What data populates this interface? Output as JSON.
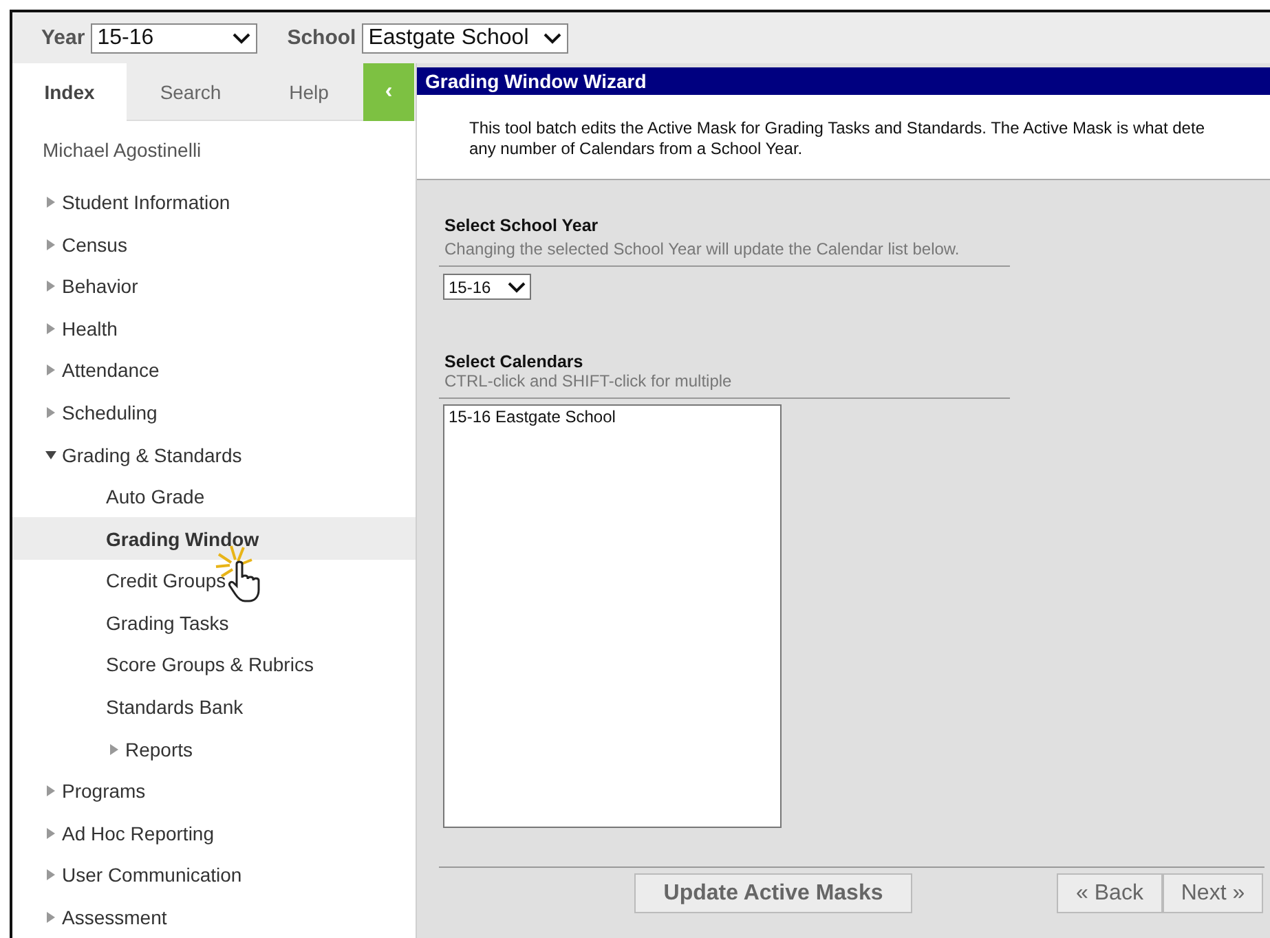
{
  "top_bar": {
    "year": {
      "label": "Year",
      "value": "15-16"
    },
    "school": {
      "label": "School",
      "value": "Eastgate School"
    }
  },
  "tabs": [
    {
      "label": "Index",
      "selected": true
    },
    {
      "label": "Search",
      "selected": false
    },
    {
      "label": "Help",
      "selected": false
    }
  ],
  "collapse_button": "‹",
  "user_name": "Michael Agostinelli",
  "tree": [
    {
      "label": "Student Information",
      "kind": "folder",
      "expanded": false,
      "selected": false
    },
    {
      "label": "Census",
      "kind": "folder",
      "expanded": false,
      "selected": false
    },
    {
      "label": "Behavior",
      "kind": "folder",
      "expanded": false,
      "selected": false
    },
    {
      "label": "Health",
      "kind": "folder",
      "expanded": false,
      "selected": false
    },
    {
      "label": "Attendance",
      "kind": "folder",
      "expanded": false,
      "selected": false
    },
    {
      "label": "Scheduling",
      "kind": "folder",
      "expanded": false,
      "selected": false
    },
    {
      "label": "Grading & Standards",
      "kind": "folder",
      "expanded": true,
      "selected": false,
      "children": [
        {
          "label": "Auto Grade",
          "kind": "leaf",
          "selected": false
        },
        {
          "label": "Grading Window",
          "kind": "leaf",
          "selected": true
        },
        {
          "label": "Credit Groups",
          "kind": "leaf",
          "selected": false
        },
        {
          "label": "Grading Tasks",
          "kind": "leaf",
          "selected": false
        },
        {
          "label": "Score Groups & Rubrics",
          "kind": "leaf",
          "selected": false
        },
        {
          "label": "Standards Bank",
          "kind": "leaf",
          "selected": false
        },
        {
          "label": "Reports",
          "kind": "folder",
          "expanded": false,
          "selected": false
        }
      ]
    },
    {
      "label": "Programs",
      "kind": "folder",
      "expanded": false,
      "selected": false
    },
    {
      "label": "Ad Hoc Reporting",
      "kind": "folder",
      "expanded": false,
      "selected": false
    },
    {
      "label": "User Communication",
      "kind": "folder",
      "expanded": false,
      "selected": false
    },
    {
      "label": "Assessment",
      "kind": "folder",
      "expanded": false,
      "selected": false
    }
  ],
  "panel": {
    "title": "Grading Window Wizard",
    "description": [
      "This tool batch edits the Active Mask for Grading Tasks and Standards. The Active Mask is what dete",
      "any number of Calendars from a School Year."
    ],
    "school_year": {
      "heading": "Select School Year",
      "hint": "Changing the selected School Year will update the Calendar list below.",
      "value": "15-16"
    },
    "calendars": {
      "heading": "Select Calendars",
      "hint": "CTRL-click and SHIFT-click for multiple",
      "items": [
        {
          "label": "15-16 Eastgate School",
          "selected": false
        }
      ]
    },
    "buttons": {
      "update": "Update Active Masks",
      "back": "« Back",
      "next": "Next »"
    }
  }
}
